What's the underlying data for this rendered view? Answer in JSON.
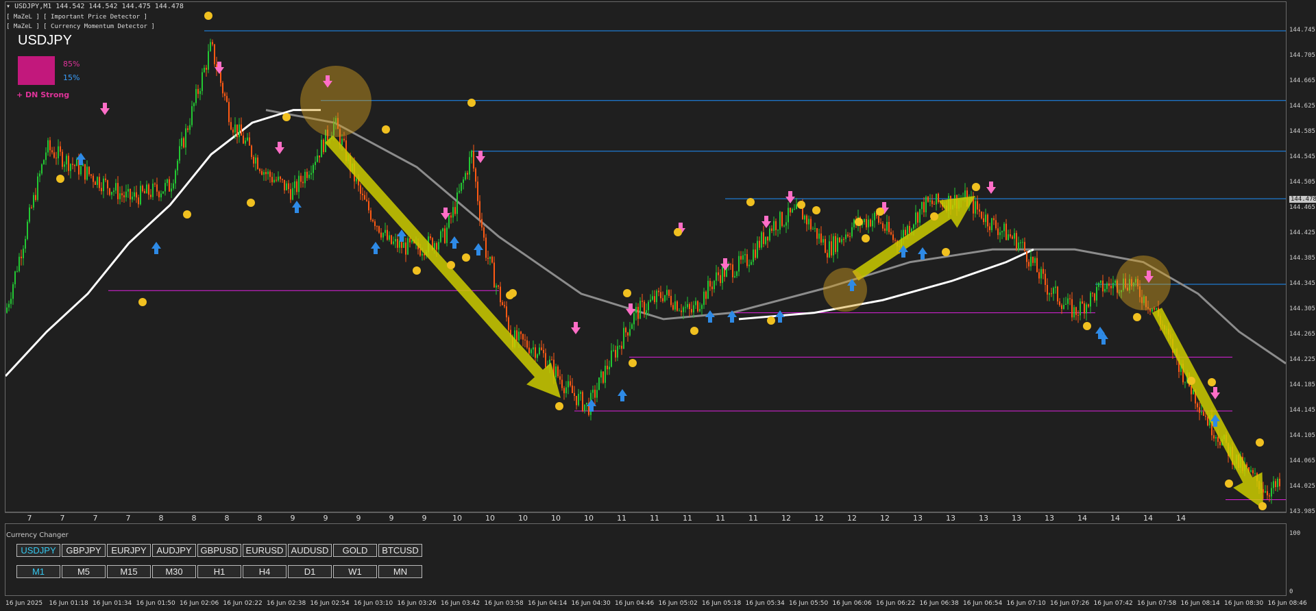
{
  "window": {
    "title": "USDJPY,M1  144.542 144.542 144.475 144.478",
    "indicators": [
      "[ MaZeL ] [ Important Price Detector ]",
      "[ MaZeL ] [ Currency Momentum Detector ]"
    ]
  },
  "momentum": {
    "symbol": "USDJPY",
    "strong_pct": "85%",
    "weak_pct": "15%",
    "signal": "+ DN Strong"
  },
  "price_axis": {
    "labels": [
      "144.745",
      "144.705",
      "144.665",
      "144.625",
      "144.585",
      "144.545",
      "144.505",
      "144.465",
      "144.425",
      "144.385",
      "144.345",
      "144.305",
      "144.265",
      "144.225",
      "144.185",
      "144.145",
      "144.105",
      "144.065",
      "144.025",
      "143.985"
    ],
    "current": "144.478",
    "min": 143.975,
    "max": 144.765
  },
  "hour_labels": [
    "7",
    "7",
    "7",
    "7",
    "8",
    "8",
    "8",
    "8",
    "9",
    "9",
    "9",
    "9",
    "9",
    "10",
    "10",
    "10",
    "10",
    "10",
    "11",
    "11",
    "11",
    "11",
    "11",
    "12",
    "12",
    "12",
    "12",
    "13",
    "13",
    "13",
    "13",
    "13",
    "14",
    "14",
    "14",
    "14"
  ],
  "colors": {
    "bull": "#23c833",
    "bear": "#ff5a14",
    "blue_level": "#1e90ff",
    "magenta_level": "#e020e0",
    "arrow_fill": "#cccc00",
    "circle": "#d4a020",
    "background": "#1f1f1f"
  },
  "chart_data": {
    "type": "candlestick",
    "symbol": "USDJPY",
    "timeframe": "M1",
    "ylim": [
      143.975,
      144.765
    ],
    "close_path": [
      [
        0,
        144.3
      ],
      [
        60,
        144.56
      ],
      [
        120,
        144.52
      ],
      [
        180,
        144.48
      ],
      [
        240,
        144.5
      ],
      [
        300,
        144.72
      ],
      [
        330,
        144.6
      ],
      [
        380,
        144.52
      ],
      [
        420,
        144.49
      ],
      [
        460,
        144.56
      ],
      [
        480,
        144.6
      ],
      [
        520,
        144.48
      ],
      [
        560,
        144.41
      ],
      [
        600,
        144.4
      ],
      [
        640,
        144.42
      ],
      [
        660,
        144.48
      ],
      [
        680,
        144.55
      ],
      [
        700,
        144.4
      ],
      [
        740,
        144.26
      ],
      [
        780,
        144.24
      ],
      [
        820,
        144.18
      ],
      [
        850,
        144.15
      ],
      [
        880,
        144.22
      ],
      [
        920,
        144.3
      ],
      [
        960,
        144.33
      ],
      [
        1000,
        144.3
      ],
      [
        1040,
        144.36
      ],
      [
        1080,
        144.38
      ],
      [
        1120,
        144.44
      ],
      [
        1160,
        144.46
      ],
      [
        1200,
        144.4
      ],
      [
        1240,
        144.44
      ],
      [
        1270,
        144.45
      ],
      [
        1300,
        144.41
      ],
      [
        1340,
        144.47
      ],
      [
        1400,
        144.48
      ],
      [
        1440,
        144.44
      ],
      [
        1480,
        144.41
      ],
      [
        1520,
        144.34
      ],
      [
        1560,
        144.3
      ],
      [
        1600,
        144.34
      ],
      [
        1640,
        144.35
      ],
      [
        1680,
        144.3
      ],
      [
        1720,
        144.2
      ],
      [
        1760,
        144.12
      ],
      [
        1800,
        144.06
      ],
      [
        1840,
        144.02
      ],
      [
        1875,
        144.03
      ]
    ],
    "blue_levels": [
      144.745,
      144.635,
      144.555,
      144.48,
      144.345
    ],
    "magenta_levels": [
      144.335,
      144.3,
      144.23,
      144.145,
      144.005
    ]
  },
  "currency_changer": {
    "title": "Currency Changer",
    "symbols": [
      "USDJPY",
      "GBPJPY",
      "EURJPY",
      "AUDJPY",
      "GBPUSD",
      "EURUSD",
      "AUDUSD",
      "GOLD",
      "BTCUSD"
    ],
    "timeframes": [
      "M1",
      "M5",
      "M15",
      "M30",
      "H1",
      "H4",
      "D1",
      "W1",
      "MN"
    ],
    "selected_symbol": "USDJPY",
    "selected_timeframe": "M1",
    "axis": [
      "100",
      "0"
    ]
  },
  "date_axis": [
    "16 Jun 2025",
    "16 Jun 01:18",
    "16 Jun 01:34",
    "16 Jun 01:50",
    "16 Jun 02:06",
    "16 Jun 02:22",
    "16 Jun 02:38",
    "16 Jun 02:54",
    "16 Jun 03:10",
    "16 Jun 03:26",
    "16 Jun 03:42",
    "16 Jun 03:58",
    "16 Jun 04:14",
    "16 Jun 04:30",
    "16 Jun 04:46",
    "16 Jun 05:02",
    "16 Jun 05:18",
    "16 Jun 05:34",
    "16 Jun 05:50",
    "16 Jun 06:06",
    "16 Jun 06:22",
    "16 Jun 06:38",
    "16 Jun 06:54",
    "16 Jun 07:10",
    "16 Jun 07:26",
    "16 Jun 07:42",
    "16 Jun 07:58",
    "16 Jun 08:14",
    "16 Jun 08:30",
    "16 Jun 08:46"
  ]
}
